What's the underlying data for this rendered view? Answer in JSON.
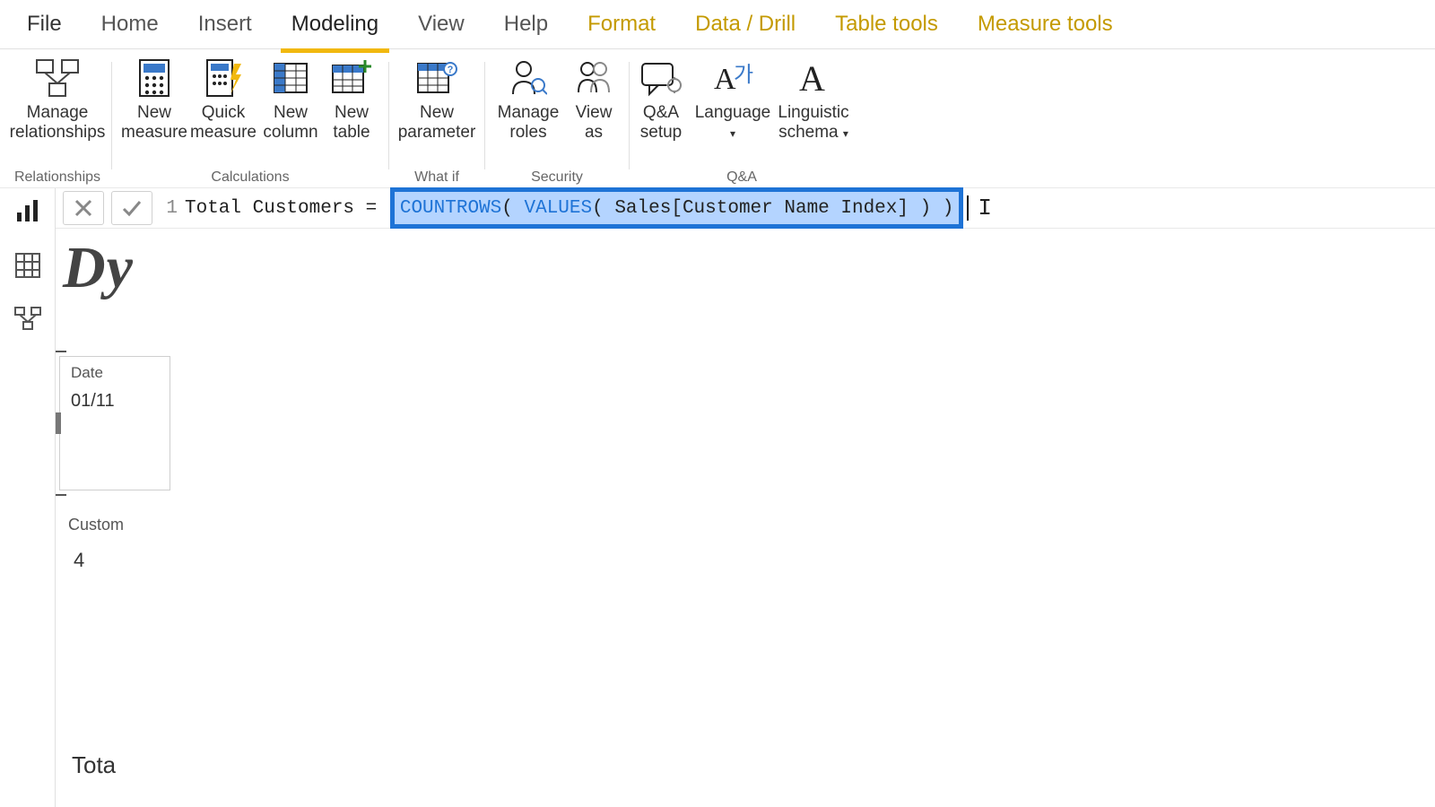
{
  "tabs": {
    "file": "File",
    "home": "Home",
    "insert": "Insert",
    "modeling": "Modeling",
    "view": "View",
    "help": "Help",
    "format": "Format",
    "data_drill": "Data / Drill",
    "table_tools": "Table tools",
    "measure_tools": "Measure tools"
  },
  "ribbon": {
    "manage_relationships": "Manage\nrelationships",
    "new_measure": "New\nmeasure",
    "quick_measure": "Quick\nmeasure",
    "new_column": "New\ncolumn",
    "new_table": "New\ntable",
    "new_parameter": "New\nparameter",
    "manage_roles": "Manage\nroles",
    "view_as": "View\nas",
    "qa_setup": "Q&A\nsetup",
    "language": "Language",
    "linguistic_schema": "Linguistic\nschema",
    "groups": {
      "relationships": "Relationships",
      "calculations": "Calculations",
      "whatif": "What if",
      "security": "Security",
      "qa": "Q&A"
    }
  },
  "formula": {
    "lineno": "1",
    "prefix": "Total Customers = ",
    "fn1": "COUNTROWS",
    "paren1": "( ",
    "fn2": "VALUES",
    "paren2": "( ",
    "id": "Sales[Customer Name Index]",
    "paren_close": " ) )"
  },
  "canvas": {
    "title_frag": "Dy",
    "card1": {
      "header": "Date",
      "value": "01/11"
    },
    "tile": {
      "label": "Custom",
      "value": "4"
    },
    "footer_frag": "Tota"
  }
}
